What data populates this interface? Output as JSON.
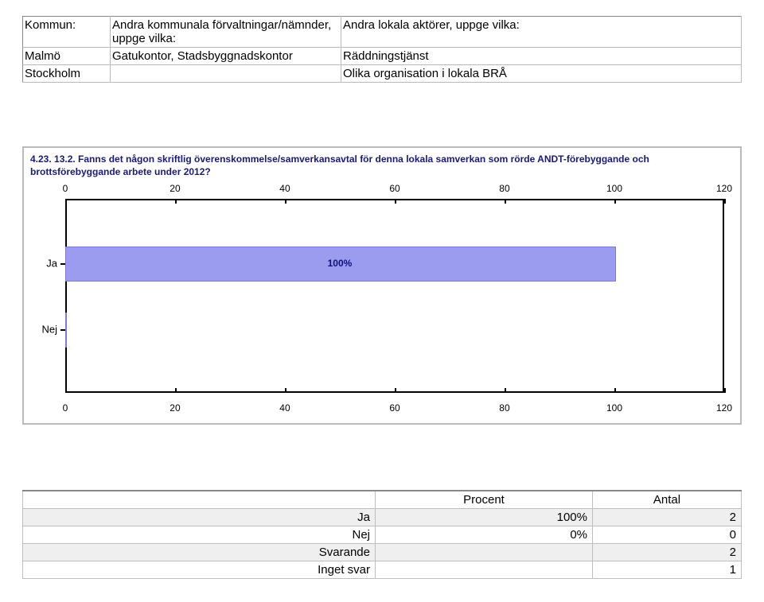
{
  "table1": {
    "headers": {
      "kommun": "Kommun:",
      "col2": "Andra kommunala förvaltningar/nämnder, uppge vilka:",
      "col3": "Andra lokala aktörer, uppge vilka:"
    },
    "rows": [
      {
        "kommun": "Malmö",
        "col2": "Gatukontor, Stadsbyggnadskontor",
        "col3": "Räddningstjänst"
      },
      {
        "kommun": "Stockholm",
        "col2": "",
        "col3": "Olika organisation i lokala BRÅ"
      }
    ]
  },
  "chart_data": {
    "type": "bar",
    "orientation": "horizontal",
    "title": "4.23. 13.2. Fanns det någon skriftlig överenskommelse/samverkansavtal för denna lokala samverkan som rörde ANDT-förebyggande och brottsförebyggande arbete under 2012?",
    "categories": [
      "Ja",
      "Nej"
    ],
    "values": [
      100,
      0
    ],
    "value_labels": [
      "100%",
      ""
    ],
    "xlim": [
      0,
      120
    ],
    "xticks": [
      0,
      20,
      40,
      60,
      80,
      100,
      120
    ],
    "xlabel": "",
    "ylabel": ""
  },
  "results": {
    "headers": {
      "procent": "Procent",
      "antal": "Antal"
    },
    "rows": [
      {
        "label": "Ja",
        "procent": "100%",
        "antal": "2",
        "alt": true
      },
      {
        "label": "Nej",
        "procent": "0%",
        "antal": "0",
        "alt": false
      },
      {
        "label": "Svarande",
        "procent": "",
        "antal": "2",
        "alt": true
      },
      {
        "label": "Inget svar",
        "procent": "",
        "antal": "1",
        "alt": false
      }
    ]
  }
}
